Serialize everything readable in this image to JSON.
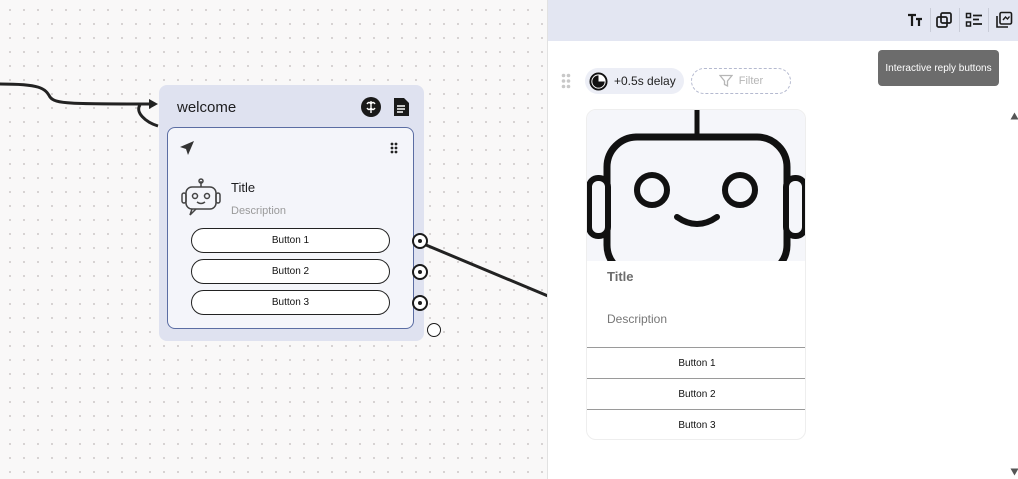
{
  "node": {
    "title": "welcome",
    "icons": [
      "ai-brain-icon",
      "notes-icon"
    ],
    "card": {
      "icons": [
        "send-icon",
        "drag-handle-icon",
        "robot-avatar-icon"
      ],
      "title": "Title",
      "description": "Description",
      "buttons": [
        "Button 1",
        "Button 2",
        "Button 3"
      ]
    }
  },
  "panel": {
    "toolbar_icons": [
      "text-format-icon",
      "copy-icon",
      "list-icon",
      "library-icon"
    ],
    "tooltip": "Interactive reply buttons",
    "delay_label": "+0.5s delay",
    "filter_label": "Filter",
    "preview": {
      "image": "robot-face-image",
      "title": "Title",
      "description": "Description",
      "buttons": [
        "Button 1",
        "Button 2",
        "Button 3"
      ]
    }
  },
  "colors": {
    "node_background": "#dfe2f0",
    "card_border": "#5b6da3",
    "toolbar_background": "#e3e6f2",
    "tooltip_background": "#6c6c6c"
  }
}
